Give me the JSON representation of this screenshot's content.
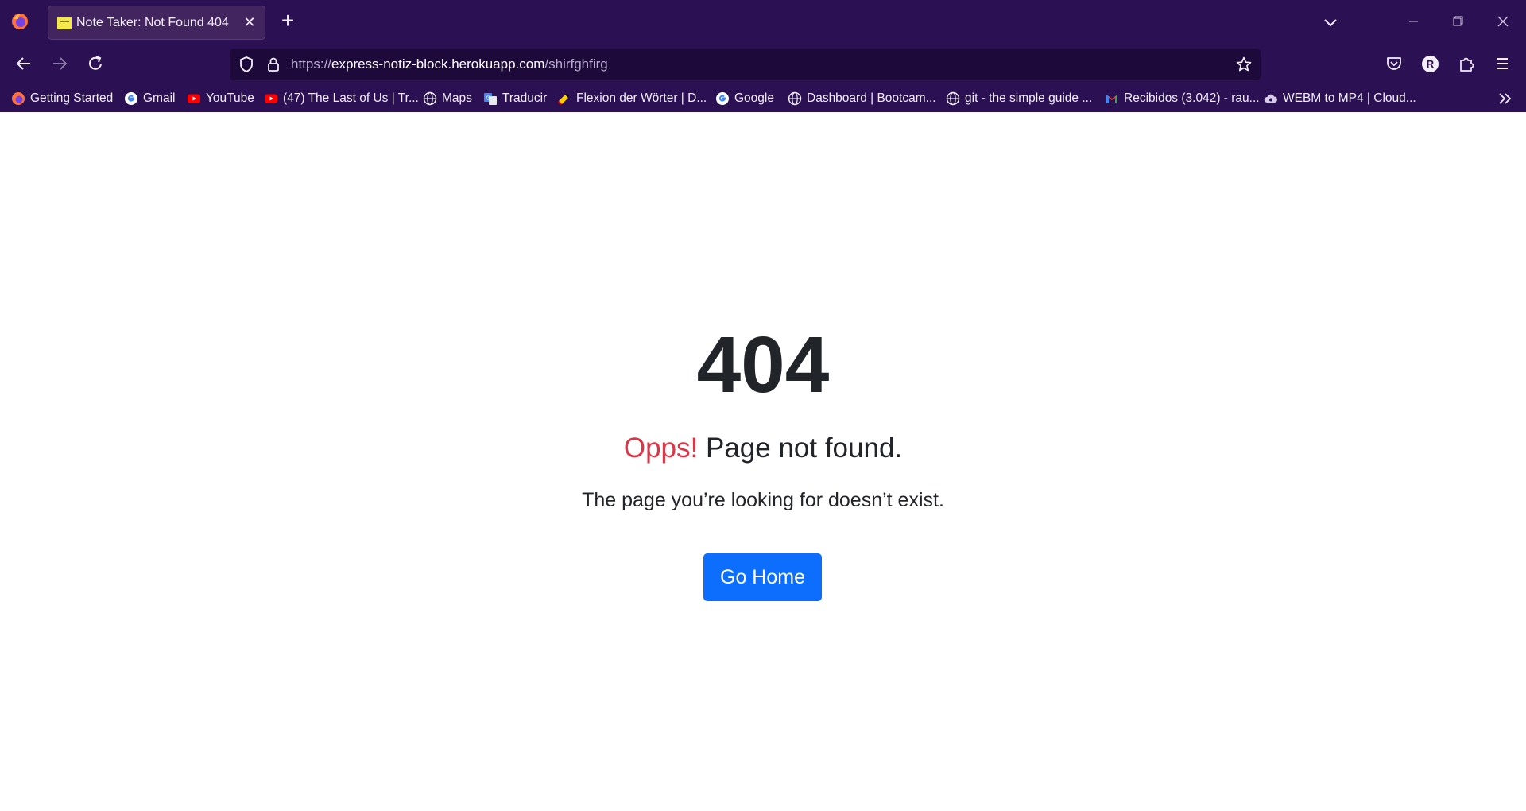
{
  "browser": {
    "tab": {
      "title": "Note Taker: Not Found 404"
    },
    "url": {
      "scheme": "https://",
      "host": "express-notiz-block.herokuapp.com",
      "path": "/shirfghfirg"
    },
    "profile_initial": "R",
    "bookmarks": [
      {
        "label": "Getting Started",
        "icon": "firefox-icon"
      },
      {
        "label": "Gmail",
        "icon": "google-icon"
      },
      {
        "label": "YouTube",
        "icon": "youtube-icon"
      },
      {
        "label": "(47) The Last of Us | Tr...",
        "icon": "youtube-icon"
      },
      {
        "label": "Maps",
        "icon": "globe-icon"
      },
      {
        "label": "Traducir",
        "icon": "translate-icon"
      },
      {
        "label": "Flexion der Wörter | D...",
        "icon": "flag-icon"
      },
      {
        "label": "Google",
        "icon": "google-icon"
      },
      {
        "label": "Dashboard | Bootcam...",
        "icon": "globe-icon"
      },
      {
        "label": "git - the simple guide ...",
        "icon": "globe-icon"
      },
      {
        "label": "Recibidos (3.042) - rau...",
        "icon": "gmail-icon"
      },
      {
        "label": "WEBM to MP4 | Cloud...",
        "icon": "cloud-icon"
      }
    ],
    "colors": {
      "chrome": "#2b1153",
      "urlbar": "#1d0a3b"
    }
  },
  "page": {
    "error_code": "404",
    "headline_accent": "Opps!",
    "headline_rest": " Page not found.",
    "message": "The page you’re looking for doesn’t exist.",
    "button_label": "Go Home",
    "colors": {
      "accent": "#dc3545",
      "button": "#0d6efd",
      "text": "#212529"
    }
  }
}
